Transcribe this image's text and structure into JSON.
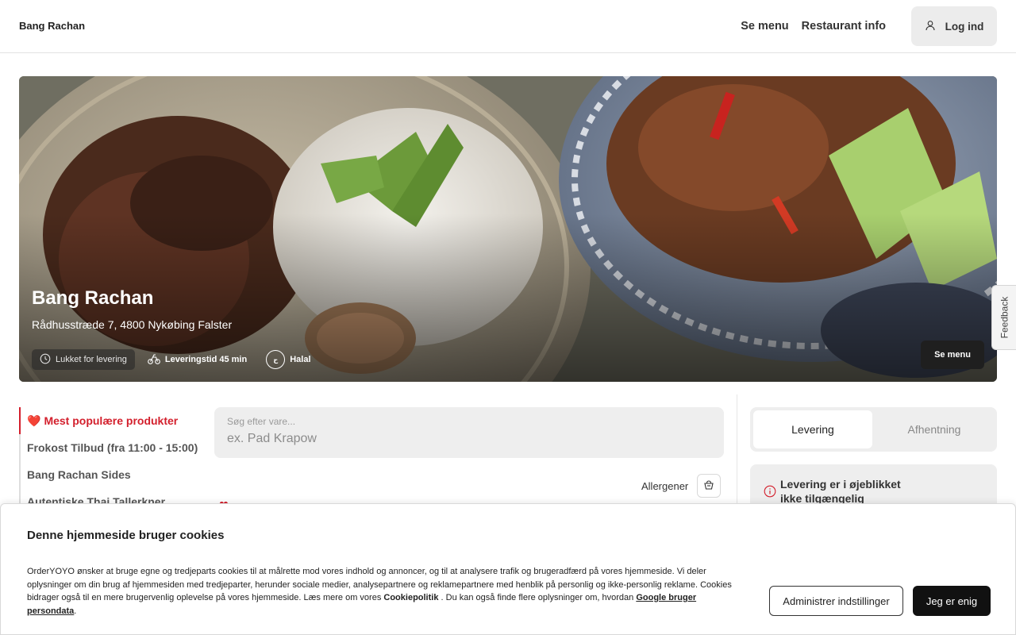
{
  "header": {
    "brand": "Bang Rachan",
    "nav": [
      "Se menu",
      "Restaurant info"
    ],
    "login_label": "Log ind"
  },
  "hero": {
    "title": "Bang Rachan",
    "address": "Rådhusstræde 7, 4800 Nykøbing Falster",
    "badges": {
      "closed": "Lukket for levering",
      "delivery_time": "Leveringstid 45 min",
      "halal": "Halal"
    },
    "menu_button": "Se menu"
  },
  "feedback": "Feedback",
  "categories": [
    {
      "label": "Mest populære produkter",
      "active": true
    },
    {
      "label": "Frokost Tilbud (fra 11:00 - 15:00)",
      "active": false
    },
    {
      "label": "Bang Rachan Sides",
      "active": false
    },
    {
      "label": "Autentiske Thai Tallerkner",
      "active": false
    }
  ],
  "search": {
    "label": "Søg efter vare...",
    "placeholder": "ex. Pad Krapow"
  },
  "allergens_label": "Allergener",
  "order_mode": {
    "delivery": "Levering",
    "pickup": "Afhentning",
    "selected": "delivery"
  },
  "notice": "Levering er i øjeblikket ikke tilgængelig",
  "cookie": {
    "title": "Denne hjemmeside bruger cookies",
    "body_part1": "OrderYOYO ønsker at bruge egne og tredjeparts cookies til at målrette mod vores indhold og annoncer, og til at analysere trafik og brugeradfærd på vores hjemmeside. Vi deler oplysninger om din brug af hjemmesiden med tredjeparter, herunder sociale medier, analysepartnere og reklamepartnere med henblik på personlig og ikke-personlig reklame. Cookies bidrager også til en mere brugervenlig oplevelse på vores hjemmeside. Læs mere om vores ",
    "policy_link": "Cookiepolitik",
    "body_part2": " . Du kan også finde flere oplysninger om, hvordan ",
    "google_link": "Google bruger persondata",
    "body_end": ".",
    "manage_button": "Administrer indstillinger",
    "accept_button": "Jeg er enig"
  },
  "colors": {
    "accent_red": "#d31f2c",
    "dark_button": "#111111",
    "panel_gray": "#eeeeee"
  },
  "icons": [
    "user-icon",
    "clock-icon",
    "bike-icon",
    "halal-icon",
    "heart-icon",
    "allergen-icon",
    "info-icon"
  ]
}
